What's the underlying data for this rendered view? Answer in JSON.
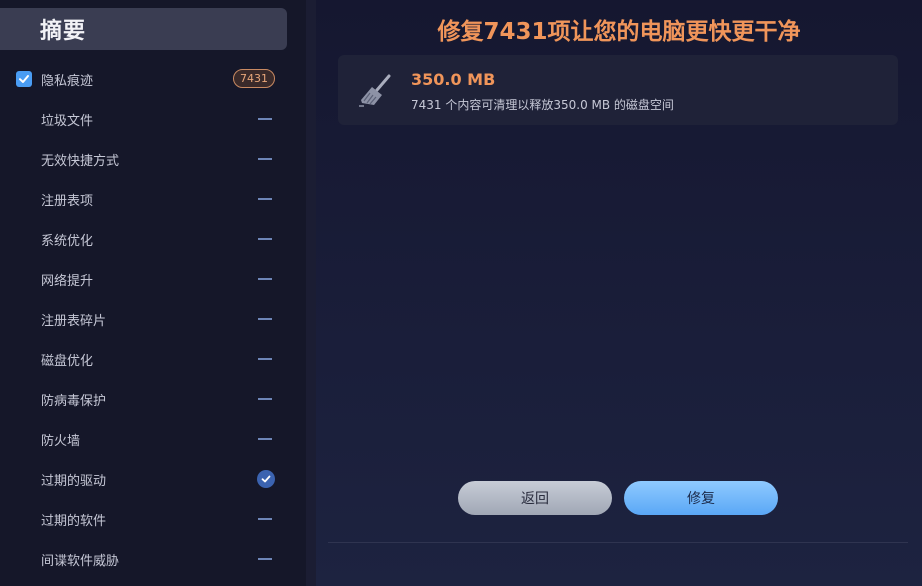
{
  "sidebar": {
    "header": "摘要",
    "items": [
      {
        "label": "隐私痕迹",
        "checked": true,
        "badge": "7431",
        "status": "badge"
      },
      {
        "label": "垃圾文件",
        "status": "dash"
      },
      {
        "label": "无效快捷方式",
        "status": "dash"
      },
      {
        "label": "注册表项",
        "status": "dash"
      },
      {
        "label": "系统优化",
        "status": "dash"
      },
      {
        "label": "网络提升",
        "status": "dash"
      },
      {
        "label": "注册表碎片",
        "status": "dash"
      },
      {
        "label": "磁盘优化",
        "status": "dash"
      },
      {
        "label": "防病毒保护",
        "status": "dash"
      },
      {
        "label": "防火墙",
        "status": "dash"
      },
      {
        "label": "过期的驱动",
        "status": "done"
      },
      {
        "label": "过期的软件",
        "status": "dash"
      },
      {
        "label": "间谍软件威胁",
        "status": "dash"
      }
    ]
  },
  "main": {
    "title": "修复7431项让您的电脑更快更干净",
    "result": {
      "icon": "broom-icon",
      "size": "350.0 MB",
      "description": "7431 个内容可清理以释放350.0 MB 的磁盘空间"
    },
    "buttons": {
      "back": "返回",
      "fix": "修复"
    }
  },
  "colors": {
    "accent_orange": "#f0955a",
    "badge_border": "#c98a62",
    "checkbox_blue": "#4a9df4",
    "fix_button": "#5aa7f6",
    "dash": "#6e86b8"
  }
}
